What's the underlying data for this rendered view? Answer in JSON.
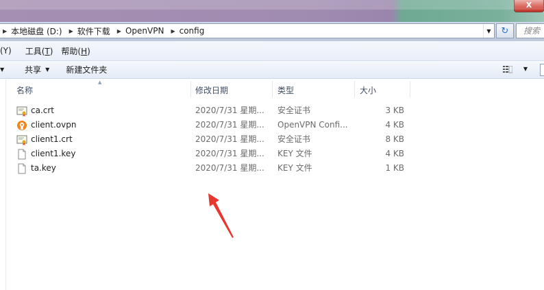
{
  "window": {
    "close_label": "X"
  },
  "address": {
    "breadcrumbs": [
      "本地磁盘 (D:)",
      "软件下载",
      "OpenVPN",
      "config"
    ],
    "search_placeholder": "搜索"
  },
  "menu": {
    "items": [
      {
        "label": "(Y)",
        "key": ""
      },
      {
        "label": "工具(",
        "key": "T",
        "suffix": ")"
      },
      {
        "label": "帮助(",
        "key": "H",
        "suffix": ")"
      }
    ]
  },
  "toolbar": {
    "share_label": "共享",
    "new_folder_label": "新建文件夹"
  },
  "columns": {
    "name": "名称",
    "date": "修改日期",
    "type": "类型",
    "size": "大小"
  },
  "files": [
    {
      "name": "ca.crt",
      "icon": "certificate-icon",
      "date": "2020/7/31 星期...",
      "type": "安全证书",
      "size": "3 KB"
    },
    {
      "name": "client.ovpn",
      "icon": "openvpn-icon",
      "date": "2020/7/31 星期...",
      "type": "OpenVPN Confi...",
      "size": "4 KB"
    },
    {
      "name": "client1.crt",
      "icon": "certificate-icon",
      "date": "2020/7/31 星期...",
      "type": "安全证书",
      "size": "8 KB"
    },
    {
      "name": "client1.key",
      "icon": "file-icon",
      "date": "2020/7/31 星期...",
      "type": "KEY 文件",
      "size": "4 KB"
    },
    {
      "name": "ta.key",
      "icon": "file-icon",
      "date": "2020/7/31 星期...",
      "type": "KEY 文件",
      "size": "1 KB"
    }
  ],
  "colors": {
    "annotation_arrow": "#e8372f",
    "header_text": "#3f4f64"
  }
}
